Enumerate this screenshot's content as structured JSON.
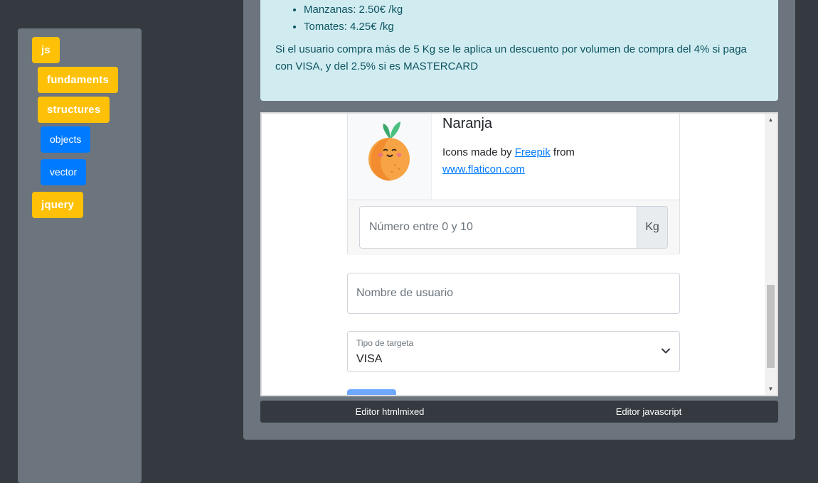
{
  "sidebar": {
    "items": [
      {
        "label": "js"
      },
      {
        "label": "fundaments"
      },
      {
        "label": "structures"
      },
      {
        "label": "objects"
      },
      {
        "label": "vector"
      },
      {
        "label": "jquery"
      }
    ]
  },
  "info": {
    "list": [
      "Manzanas: 2.50€ /kg",
      "Tomates: 4.25€ /kg"
    ],
    "paragraph": "Si el usuario compra más de 5 Kg se le aplica un descuento por volumen de compra del 4% si paga con VISA, y del 2.5% si es MASTERCARD"
  },
  "preview": {
    "card": {
      "title": "Naranja",
      "credit_prefix": "Icons made by ",
      "credit_link1": "Freepik",
      "credit_mid": " from ",
      "credit_link2": "www.flaticon.com",
      "icon": "orange-fruit-icon"
    },
    "kg_input": {
      "placeholder": "Número entre 0 y 10",
      "addon": "Kg"
    },
    "username": {
      "placeholder": "Nombre de usuario"
    },
    "card_type": {
      "label": "Tipo de targeta",
      "value": "VISA"
    }
  },
  "editor": {
    "tabs": [
      "Editor htmlmixed",
      "Editor javascript"
    ]
  },
  "colors": {
    "yellow": "#ffc107",
    "blue": "#007bff",
    "info_bg": "#d1ecf1",
    "info_text": "#0c5460"
  }
}
